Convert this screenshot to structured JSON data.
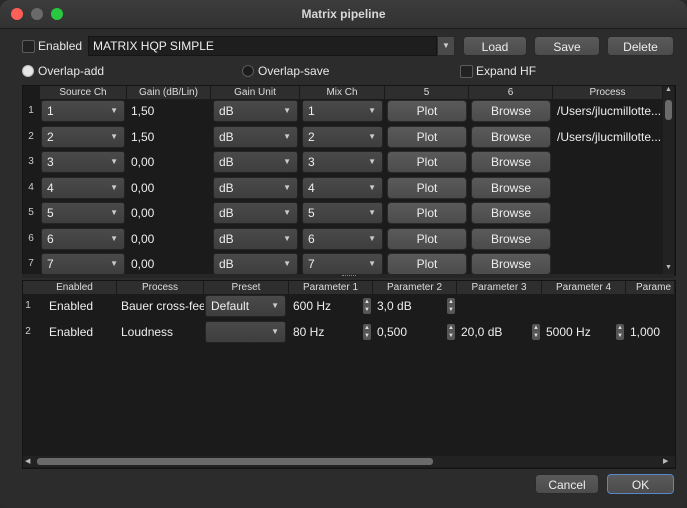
{
  "window": {
    "title": "Matrix pipeline"
  },
  "top": {
    "enabled_label": "Enabled",
    "preset_name": "MATRIX HQP SIMPLE",
    "load_label": "Load",
    "save_label": "Save",
    "delete_label": "Delete",
    "overlap_add_label": "Overlap-add",
    "overlap_save_label": "Overlap-save",
    "expand_hf_label": "Expand HF"
  },
  "matrix_table": {
    "headers": [
      "Source Ch",
      "Gain (dB/Lin)",
      "Gain Unit",
      "Mix Ch",
      "5",
      "6",
      "Process"
    ],
    "rows": [
      {
        "num": "1",
        "source": "1",
        "gain": "1,50",
        "unit": "dB",
        "mix": "1",
        "plot": "Plot",
        "browse": "Browse",
        "process": "/Users/jlucmillotte..."
      },
      {
        "num": "2",
        "source": "2",
        "gain": "1,50",
        "unit": "dB",
        "mix": "2",
        "plot": "Plot",
        "browse": "Browse",
        "process": "/Users/jlucmillotte..."
      },
      {
        "num": "3",
        "source": "3",
        "gain": "0,00",
        "unit": "dB",
        "mix": "3",
        "plot": "Plot",
        "browse": "Browse",
        "process": ""
      },
      {
        "num": "4",
        "source": "4",
        "gain": "0,00",
        "unit": "dB",
        "mix": "4",
        "plot": "Plot",
        "browse": "Browse",
        "process": ""
      },
      {
        "num": "5",
        "source": "5",
        "gain": "0,00",
        "unit": "dB",
        "mix": "5",
        "plot": "Plot",
        "browse": "Browse",
        "process": ""
      },
      {
        "num": "6",
        "source": "6",
        "gain": "0,00",
        "unit": "dB",
        "mix": "6",
        "plot": "Plot",
        "browse": "Browse",
        "process": ""
      },
      {
        "num": "7",
        "source": "7",
        "gain": "0,00",
        "unit": "dB",
        "mix": "7",
        "plot": "Plot",
        "browse": "Browse",
        "process": ""
      }
    ]
  },
  "filter_table": {
    "headers": [
      "Enabled",
      "Process",
      "Preset",
      "Parameter 1",
      "Parameter 2",
      "Parameter 3",
      "Parameter 4",
      "Parame"
    ],
    "rows": [
      {
        "num": "1",
        "enabled": "Enabled",
        "process": "Bauer cross-feed",
        "preset": "Default",
        "p1": "600 Hz",
        "p2": "3,0 dB",
        "p3": "",
        "p4": "",
        "p5": ""
      },
      {
        "num": "2",
        "enabled": "Enabled",
        "process": "Loudness",
        "preset": "",
        "p1": "80 Hz",
        "p2": "0,500",
        "p3": "20,0 dB",
        "p4": "5000 Hz",
        "p5": "1,000"
      }
    ]
  },
  "footer": {
    "cancel_label": "Cancel",
    "ok_label": "OK"
  },
  "colors": {
    "ok_border": "#5a86c5",
    "close": "#ff5f57",
    "minimize": "#febc2e",
    "zoom": "#28c840"
  }
}
